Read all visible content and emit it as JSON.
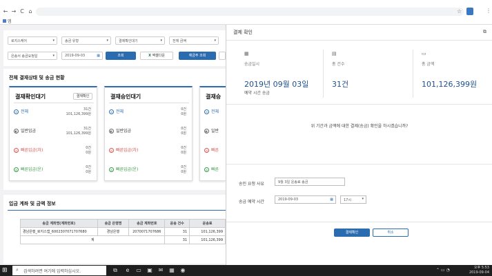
{
  "browser": {
    "back": "←",
    "forward": "→",
    "reload": "C",
    "home": "⌂",
    "bookmark_label": "앱"
  },
  "filters": {
    "row1": [
      "로지스케어",
      "송금 유형",
      "결제확인대기",
      "전체 금액"
    ],
    "row2_select": "은송서 송금요청일",
    "date": "2019-09-03",
    "search_btn": "조회",
    "excel_btn": "엑셀다운",
    "deposit_btn": "예금주 조회"
  },
  "status": {
    "title": "전체 결재상태 및 송금 현황",
    "cards": [
      {
        "title": "결재확인대기",
        "button": "결재확인",
        "rows": [
          {
            "label": "전체",
            "count": "31건",
            "amount": "101,126,399원",
            "color": "#2b6cb0"
          },
          {
            "label": "일반입금",
            "count": "31건",
            "amount": "101,126,399원",
            "color": "#444"
          },
          {
            "label": "빠른입금(차)",
            "count": "0건",
            "amount": "0원",
            "color": "#d9534f"
          },
          {
            "label": "빠른입금(운)",
            "count": "0건",
            "amount": "0원",
            "color": "#3a9a4a"
          }
        ]
      },
      {
        "title": "결재승인대기",
        "rows": [
          {
            "label": "전체",
            "count": "0건",
            "amount": "0원",
            "color": "#2b6cb0"
          },
          {
            "label": "일반입금",
            "count": "0건",
            "amount": "0원",
            "color": "#444"
          },
          {
            "label": "빠른입금(차)",
            "count": "0건",
            "amount": "0원",
            "color": "#d9534f"
          },
          {
            "label": "빠른입금(운)",
            "count": "0건",
            "amount": "0원",
            "color": "#3a9a4a"
          }
        ]
      },
      {
        "title": "결재승",
        "rows": [
          {
            "label": "전체",
            "color": "#2b6cb0"
          },
          {
            "label": "일반",
            "color": "#444"
          },
          {
            "label": "빠른",
            "color": "#d9534f"
          },
          {
            "label": "빠른",
            "color": "#3a9a4a"
          }
        ]
      }
    ]
  },
  "account": {
    "title": "입금 계좌 및 금액 정보",
    "headers": [
      "송금 계좌명(계좌번호)",
      "송금 은행명",
      "송금 계좌번호",
      "운송 건수",
      "운송료"
    ],
    "rows": [
      [
        "경남은행_로지스앱_6002307071707680",
        "경남은행",
        "2070071707686",
        "31",
        "101,126,399"
      ],
      [
        "계",
        "",
        "",
        "31",
        "101,126,399"
      ]
    ]
  },
  "dialog": {
    "title": "결제 확인",
    "stats": [
      {
        "icon": "calendar-icon",
        "label": "송금일시",
        "value": "2019년 09월 03일",
        "sub": "예약 시간 송금"
      },
      {
        "icon": "document-icon",
        "label": "총 건수",
        "value": "31건"
      },
      {
        "icon": "wallet-icon",
        "label": "총 금액",
        "value": "101,126,399원"
      }
    ],
    "question": "위 기간과 금액에 대한 결제(송금) 확인을 하시겠습니까?",
    "memo_label": "송인 요청 사유",
    "memo_value": "9월 3일 운송료 송금",
    "time_label": "송금 예약 시간",
    "time_date": "2019-09-03",
    "time_hour": "17시",
    "confirm": "결제확인",
    "cancel": "취소"
  },
  "taskbar": {
    "search_placeholder": "검색하려면 여기에 입력하십시오.",
    "time": "오후 5:53",
    "date": "2019-09-04"
  },
  "colors": {
    "accent": "#2b6cb0",
    "taskbar": "#1f1f1f"
  }
}
